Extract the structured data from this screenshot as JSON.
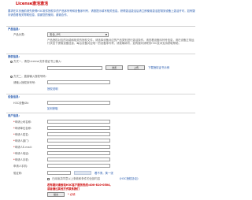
{
  "page_title": "License激活激活",
  "intro": "要求在本页面前请先获得H3C软件授权中的产品序列号和设备序列号，请按提示填写相关信息。获得激活激活后请立即使用激活密钥到设备上激活许可，如有疑问请查看相关帮助信息，感谢您的使用，谢谢合作。",
  "product_section": {
    "heading": "产品信息:",
    "type_label": "产品分类:",
    "type_value": "安全_IPS",
    "description": "产品授权对应的功能和相关的授权文件，请选择设备对应的产品类别进行激活操作。请查看设备序列号信息，请在设备正常运行状态下提取设备信息，每台设备对应唯一的设备序列号，请准确填写，如有疑问请联系H3C技术支持获取帮助。"
  },
  "license_section": {
    "heading": "授权信息:",
    "option1": "方式一，请在License文件或证书上输入:",
    "option2": "方式二，直接输入授权号码:",
    "serial_label": "请输入授权序列号:",
    "browse_button": "浏览",
    "upload_button": "上传",
    "download_link": "下载授权证书示例",
    "help_link": "授权说明"
  },
  "device_section": {
    "heading": "设备信息:",
    "sn_label": "H3C设备SN:",
    "help_link": "如何获取"
  },
  "user_section": {
    "heading": "用户信息:",
    "fields": [
      {
        "label": "申请公司名称:",
        "required": true
      },
      {
        "label": "申请单位名称:",
        "required": true
      },
      {
        "label": "申请人姓名:",
        "required": true
      },
      {
        "label": "申请人部门:",
        "required": true
      },
      {
        "label": "申请人E-mail:",
        "required": true
      },
      {
        "label": "申请人电话:",
        "required": true
      },
      {
        "label": "申请人手机:",
        "required": true
      },
      {
        "label": "申请人手机:",
        "required": false
      }
    ],
    "captcha_label": "验证码:",
    "captcha_text": "看不清，换一张"
  },
  "agreement": {
    "text": "已阅读并同意以上条款和条件的全部内容",
    "link": "《H3C授权协议》"
  },
  "notice": {
    "line1": "若有疑问请致电H3C客户服务热线:400-810-0504,",
    "line2": "或者通过其他方式联系我们",
    "required_note": "* 必填"
  },
  "submit_label": "提交",
  "colors": {
    "accent": "#2a5db0",
    "alert": "#cc0000"
  }
}
